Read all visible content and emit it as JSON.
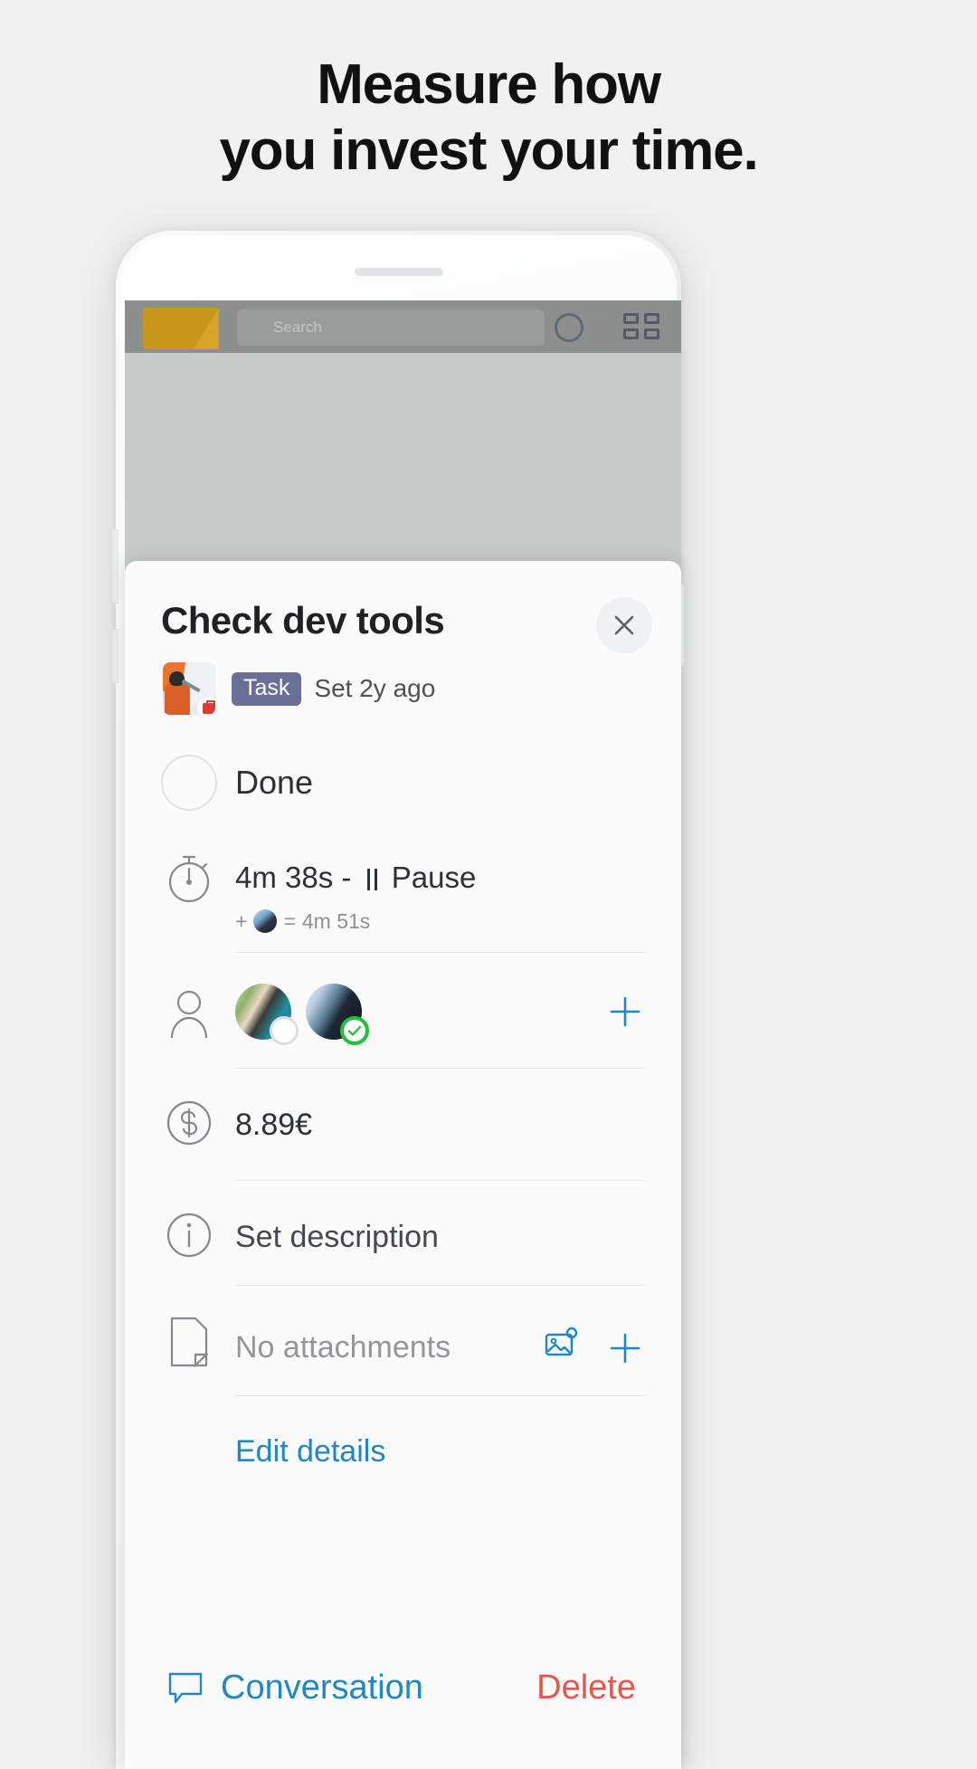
{
  "headline": {
    "line1": "Measure how",
    "line2": "you invest your time."
  },
  "app_background": {
    "search_placeholder": "Search",
    "folder_icon": "folder-icon",
    "avatar_icon": "account-circle-icon",
    "grid_icon": "grid-view-icon"
  },
  "sheet": {
    "title": "Check dev tools",
    "close_icon": "close-icon",
    "meta": {
      "project_thumb": "project-photo",
      "project_badge_icon": "briefcase-icon",
      "type_badge": "Task",
      "set_time": "Set 2y ago"
    },
    "rows": {
      "done": {
        "label": "Done",
        "icon": "empty-check-circle-icon",
        "checked": false
      },
      "timer": {
        "icon": "stopwatch-icon",
        "elapsed": "4m 38s",
        "separator": "-",
        "pause_icon": "pause-icon",
        "pause_label": "Pause",
        "sub_prefix": "+",
        "sub_avatar": "member-avatar",
        "sub_equals": "=",
        "sub_total": "4m 51s"
      },
      "assignees": {
        "icon": "person-outline-icon",
        "members": [
          {
            "name": "member-avatar-1",
            "status": "pending",
            "badge_icon": "empty-circle-icon"
          },
          {
            "name": "member-avatar-2",
            "status": "accepted",
            "badge_icon": "check-circle-icon"
          }
        ],
        "add_icon": "plus-icon"
      },
      "price": {
        "icon": "dollar-circle-icon",
        "value": "8.89€"
      },
      "description": {
        "icon": "info-circle-icon",
        "label": "Set description"
      },
      "attachments": {
        "icon": "document-icon",
        "label": "No attachments",
        "image_icon": "image-attachment-icon",
        "add_icon": "plus-icon"
      }
    },
    "edit_details": "Edit details",
    "footer": {
      "conversation_icon": "chat-bubble-icon",
      "conversation_label": "Conversation",
      "delete_label": "Delete"
    }
  },
  "colors": {
    "page_bg": "#f1f1f1",
    "accent_blue": "#1f87c4",
    "delete_red": "#e8554a",
    "task_badge": "#6a6f96",
    "accepted_green": "#1fc23a"
  }
}
